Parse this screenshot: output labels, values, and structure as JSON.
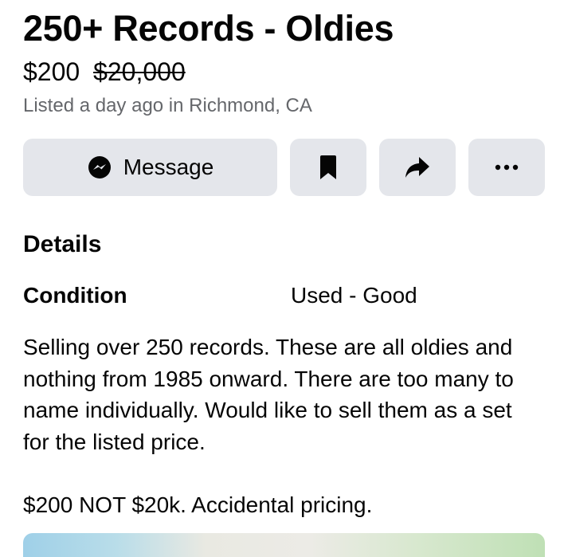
{
  "listing": {
    "title": "250+ Records - Oldies",
    "price": "$200",
    "original_price": "$20,000",
    "listed_info": "Listed a day ago in Richmond, CA"
  },
  "actions": {
    "message_label": "Message",
    "message_icon": "messenger-icon",
    "save_icon": "bookmark-icon",
    "share_icon": "share-icon",
    "more_icon": "more-options-icon"
  },
  "details": {
    "heading": "Details",
    "condition_label": "Condition",
    "condition_value": "Used - Good",
    "description_paragraph_1": "Selling over 250 records. These are all oldies and nothing from 1985 onward. There are too many to name individually. Would like to sell them as a set for the listed price.",
    "description_paragraph_2": "$200 NOT $20k. Accidental pricing."
  },
  "colors": {
    "button_bg": "#e4e6eb",
    "text_primary": "#050505",
    "text_secondary": "#65676b"
  }
}
